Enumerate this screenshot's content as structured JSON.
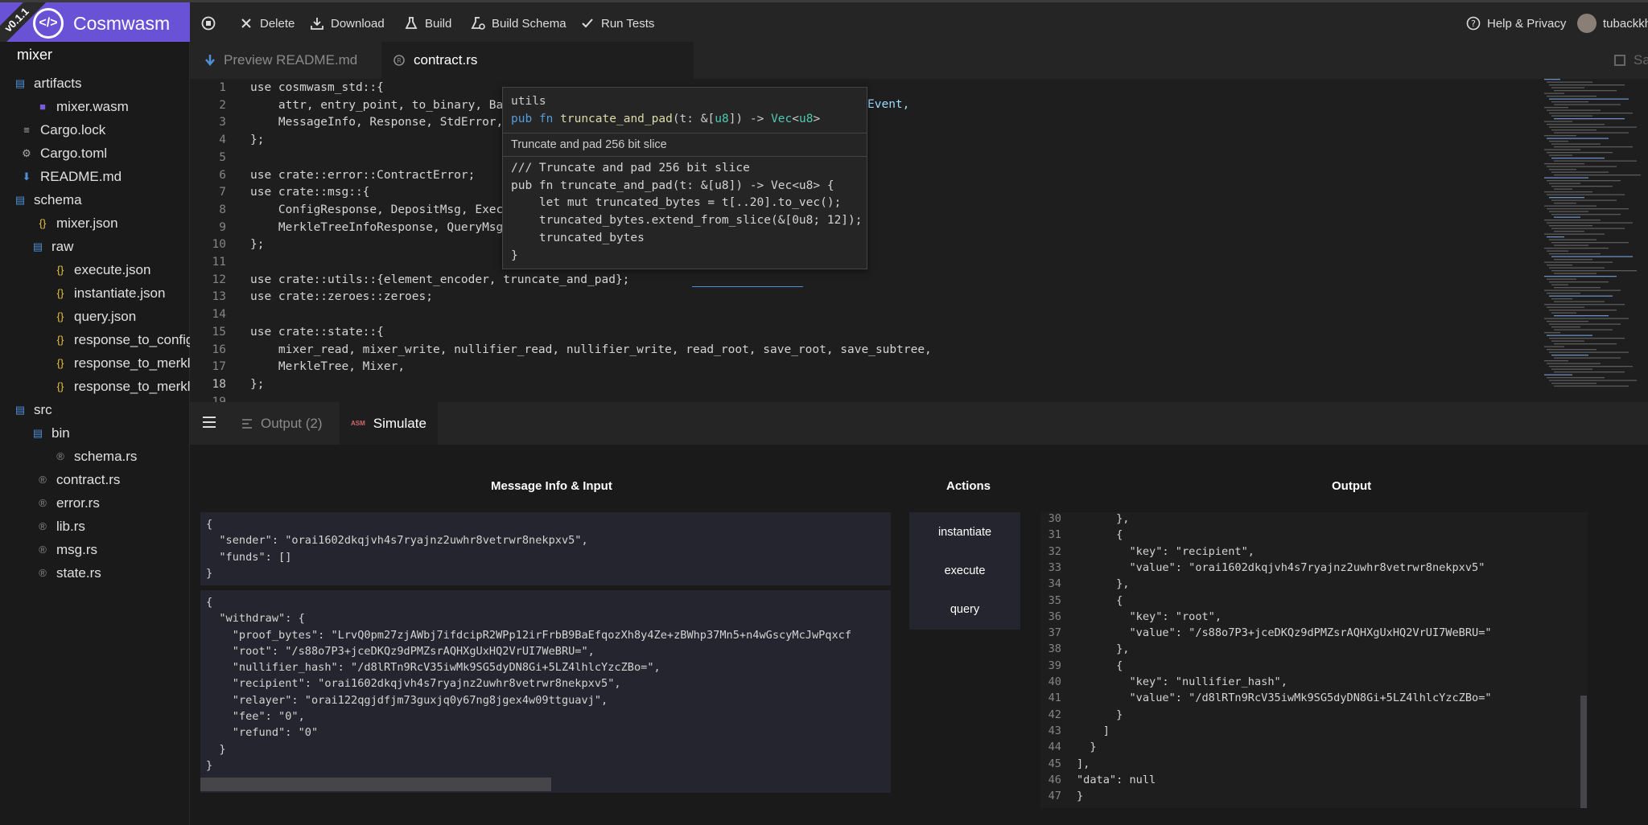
{
  "brand": {
    "version": "v0.1.1",
    "name": "Cosmwasm"
  },
  "toolbar": {
    "delete": "Delete",
    "download": "Download",
    "build": "Build",
    "build_schema": "Build Schema",
    "run_tests": "Run Tests",
    "help": "Help & Privacy",
    "user": "tubackkh"
  },
  "sidebar": {
    "project": "mixer",
    "items": [
      {
        "label": "artifacts",
        "icon": "folder-icon"
      },
      {
        "label": "mixer.wasm",
        "icon": "wasm-file-icon"
      },
      {
        "label": "Cargo.lock",
        "icon": "lock-file-icon"
      },
      {
        "label": "Cargo.toml",
        "icon": "gear-icon"
      },
      {
        "label": "README.md",
        "icon": "markdown-icon"
      },
      {
        "label": "schema",
        "icon": "folder-icon"
      },
      {
        "label": "mixer.json",
        "icon": "json-icon"
      },
      {
        "label": "raw",
        "icon": "folder-icon"
      },
      {
        "label": "execute.json",
        "icon": "json-icon"
      },
      {
        "label": "instantiate.json",
        "icon": "json-icon"
      },
      {
        "label": "query.json",
        "icon": "json-icon"
      },
      {
        "label": "response_to_config.",
        "icon": "json-icon"
      },
      {
        "label": "response_to_merkle",
        "icon": "json-icon"
      },
      {
        "label": "response_to_merkle",
        "icon": "json-icon"
      },
      {
        "label": "src",
        "icon": "folder-icon"
      },
      {
        "label": "bin",
        "icon": "folder-icon"
      },
      {
        "label": "schema.rs",
        "icon": "rust-icon"
      },
      {
        "label": "contract.rs",
        "icon": "rust-icon"
      },
      {
        "label": "error.rs",
        "icon": "rust-icon"
      },
      {
        "label": "lib.rs",
        "icon": "rust-icon"
      },
      {
        "label": "msg.rs",
        "icon": "rust-icon"
      },
      {
        "label": "state.rs",
        "icon": "rust-icon"
      }
    ]
  },
  "tabs": {
    "preview": "Preview README.md",
    "contract": "contract.rs",
    "save": "Sa"
  },
  "hover": {
    "module": "utils",
    "signature": "pub fn truncate_and_pad(t: &[u8]) -> Vec<u8>",
    "doc": "Truncate and pad 256 bit slice",
    "body": [
      "/// Truncate and pad 256 bit slice",
      "pub fn truncate_and_pad(t: &[u8]) -> Vec<u8> {",
      "    let mut truncated_bytes = t[..20].to_vec();",
      "    truncated_bytes.extend_from_slice(&[0u8; 12]);",
      "    truncated_bytes",
      "}"
    ]
  },
  "code": {
    "line_numbers": [
      "1",
      "2",
      "3",
      "4",
      "5",
      "6",
      "7",
      "8",
      "9",
      "10",
      "11",
      "12",
      "13",
      "14",
      "15",
      "16",
      "17",
      "18",
      "19"
    ],
    "event_fragment": "Event,",
    "lines": [
      "use cosmwasm_std::{",
      "    attr, entry_point, to_binary, Ba",
      "    MessageInfo, Response, StdError,",
      "};",
      "",
      "use crate::error::ContractError;",
      "use crate::msg::{",
      "    ConfigResponse, DepositMsg, Exec",
      "    MerkleTreeInfoResponse, QueryMsg",
      "};",
      "",
      "use crate::utils::{element_encoder, truncate_and_pad};",
      "use crate::zeroes::zeroes;",
      "",
      "use crate::state::{",
      "    mixer_read, mixer_write, nullifier_read, nullifier_write, read_root, save_root, save_subtree,",
      "    MerkleTree, Mixer,",
      "};",
      ""
    ]
  },
  "panel": {
    "output_tab": "Output (2)",
    "simulate_tab": "Simulate",
    "col_input": "Message Info & Input",
    "col_actions": "Actions",
    "col_output": "Output"
  },
  "msg_info": [
    "{",
    "  \"sender\": \"orai1602dkqjvh4s7ryajnz2uwhr8vetrwr8nekpxv5\",",
    "  \"funds\": []",
    "}"
  ],
  "input": [
    "{",
    "  \"withdraw\": {",
    "    \"proof_bytes\": \"LrvQ0pm27zjAWbj7ifdcipR2WPp12irFrbB9BaEfqozXh8y4Ze+zBWhp37Mn5+n4wGscyMcJwPqxcf",
    "    \"root\": \"/s88o7P3+jceDKQz9dPMZsrAQHXgUxHQ2VrUI7WeBRU=\",",
    "    \"nullifier_hash\": \"/d8lRTn9RcV35iwMk9SG5dyDN8Gi+5LZ4lhlcYzcZBo=\",",
    "    \"recipient\": \"orai1602dkqjvh4s7ryajnz2uwhr8vetrwr8nekpxv5\",",
    "    \"relayer\": \"orai122qgjdfjm73guxjq0y67ng8jgex4w09ttguavj\",",
    "    \"fee\": \"0\",",
    "    \"refund\": \"0\"",
    "  }",
    "}"
  ],
  "actions": [
    "instantiate",
    "execute",
    "query"
  ],
  "output": {
    "line_numbers": [
      "30",
      "31",
      "32",
      "33",
      "34",
      "35",
      "36",
      "37",
      "38",
      "39",
      "40",
      "41",
      "42",
      "43",
      "44",
      "45",
      "46",
      "47"
    ],
    "lines": [
      "      },",
      "      {",
      "        \"key\": \"recipient\",",
      "        \"value\": \"orai1602dkqjvh4s7ryajnz2uwhr8vetrwr8nekpxv5\"",
      "      },",
      "      {",
      "        \"key\": \"root\",",
      "        \"value\": \"/s88o7P3+jceDKQz9dPMZsrAQHXgUxHQ2VrUI7WeBRU=\"",
      "      },",
      "      {",
      "        \"key\": \"nullifier_hash\",",
      "        \"value\": \"/d8lRTn9RcV35iwMk9SG5dyDN8Gi+5LZ4lhlcYzcZBo=\"",
      "      }",
      "    ]",
      "  }",
      "],",
      "\"data\": null",
      "}"
    ]
  },
  "colors": {
    "brand": "#6a52d6",
    "folder": "#4f8fd6",
    "json": "#e8c547"
  }
}
